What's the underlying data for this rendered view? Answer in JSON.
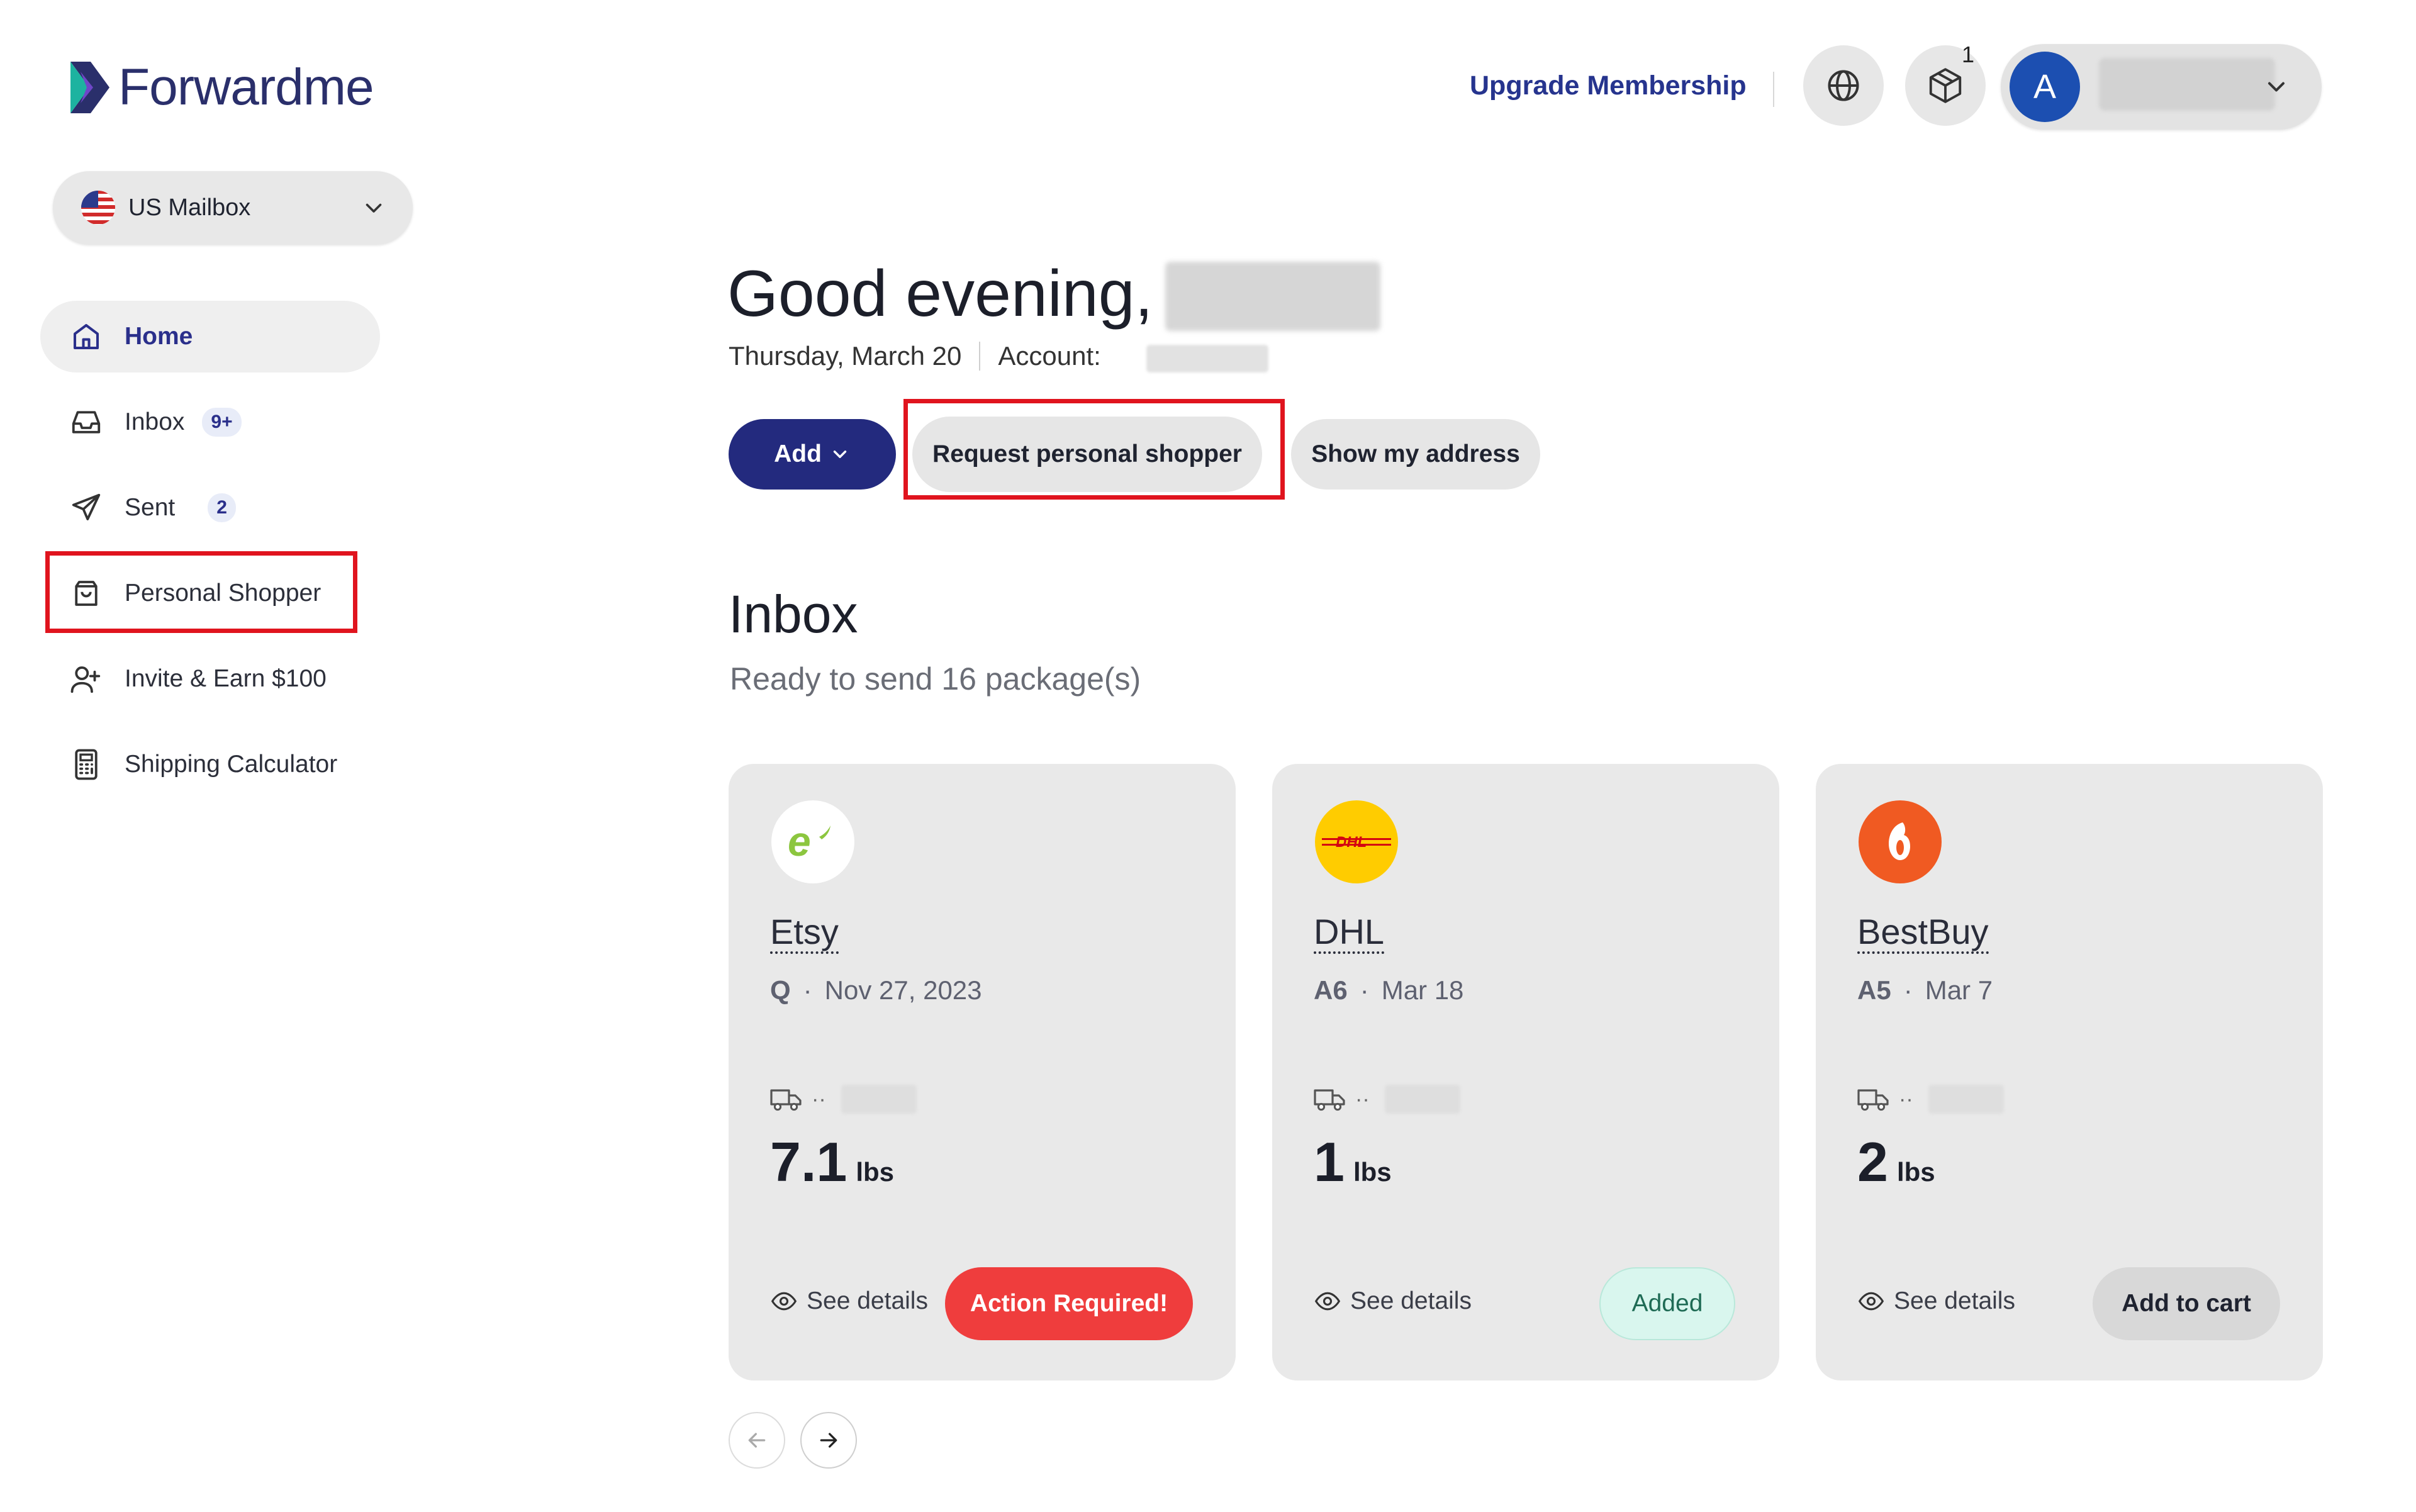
{
  "app": {
    "brand": "Forwardme"
  },
  "mailbox": {
    "label": "US Mailbox"
  },
  "sidebar": {
    "items": [
      {
        "label": "Home",
        "icon": "home-icon",
        "active": true
      },
      {
        "label": "Inbox",
        "icon": "inbox-icon",
        "badge": "9+"
      },
      {
        "label": "Sent",
        "icon": "send-icon",
        "badge": "2"
      },
      {
        "label": "Personal Shopper",
        "icon": "shopping-bag-icon"
      },
      {
        "label": "Invite & Earn $100",
        "icon": "add-user-icon"
      },
      {
        "label": "Shipping Calculator",
        "icon": "calculator-icon"
      }
    ]
  },
  "header": {
    "upgrade_label": "Upgrade Membership",
    "cart_count": "1",
    "avatar_initial": "A"
  },
  "greeting": {
    "text": "Good evening,",
    "date": "Thursday, March 20",
    "account_label": "Account:"
  },
  "actions": {
    "add_label": "Add",
    "request_label": "Request personal shopper",
    "address_label": "Show my address"
  },
  "inbox": {
    "title": "Inbox",
    "subtitle": "Ready to send 16 package(s)",
    "cards": [
      {
        "store": "Etsy",
        "code": "Q",
        "date": "Nov 27, 2023",
        "truck_text": "··",
        "weight": "7.1",
        "unit": "lbs",
        "details_label": "See details",
        "action_label": "Action Required!",
        "action_color": "#ef3d3d"
      },
      {
        "store": "DHL",
        "code": "A6",
        "date": "Mar 18",
        "truck_text": "··",
        "weight": "1",
        "unit": "lbs",
        "details_label": "See details",
        "action_label": "Added",
        "action_color": "#d9f6ee"
      },
      {
        "store": "BestBuy",
        "code": "A5",
        "date": "Mar 7",
        "truck_text": "··",
        "weight": "2",
        "unit": "lbs",
        "details_label": "See details",
        "action_label": "Add to cart",
        "action_color": "#d8d8d8"
      }
    ]
  },
  "dot_separator": "·",
  "colors": {
    "brand_navy": "#232a7e",
    "highlight_red": "#e0141e",
    "danger": "#ef3d3d"
  }
}
